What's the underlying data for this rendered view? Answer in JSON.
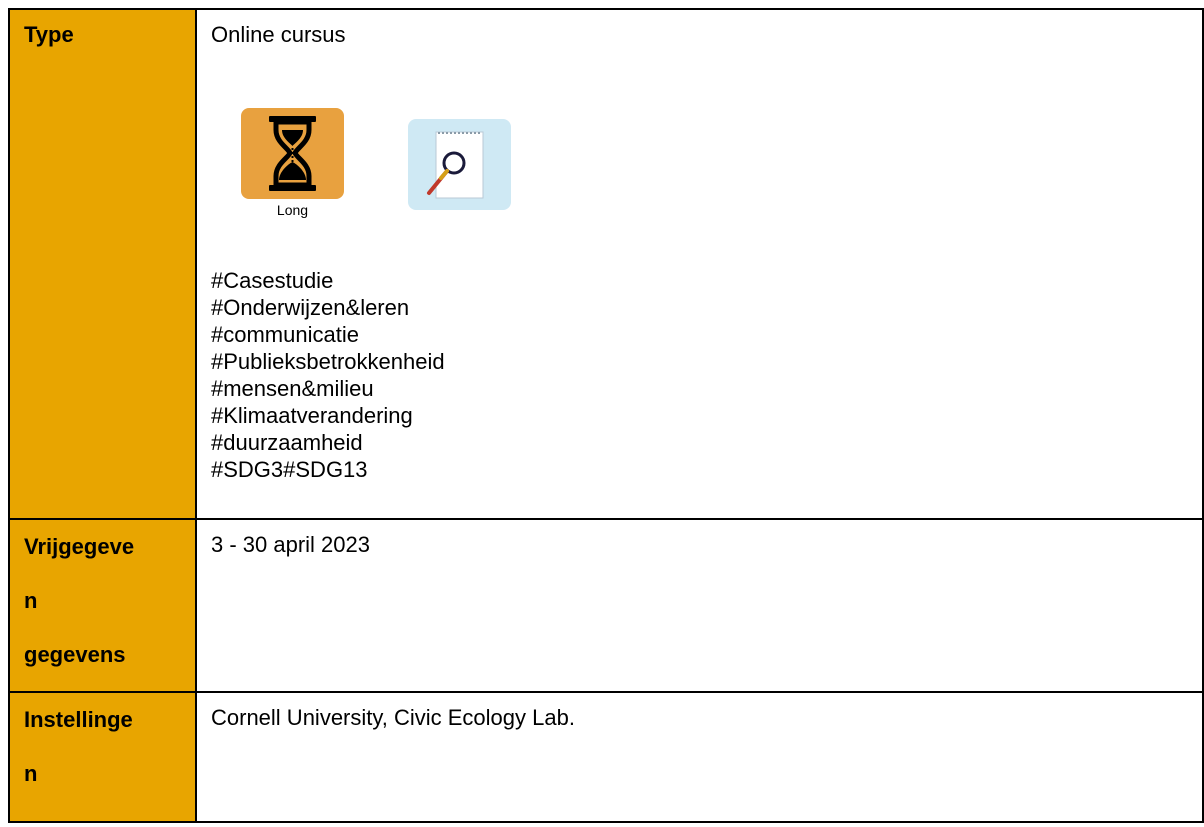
{
  "rows": {
    "type": {
      "label": "Type",
      "value": "Online cursus",
      "icons": {
        "long": {
          "name": "hourglass-icon",
          "caption": "Long",
          "bg": "#e8a13f"
        },
        "search": {
          "name": "magnifier-notepad-icon",
          "bg": "#cfe9f4"
        }
      },
      "tags": [
        "#Casestudie",
        "#Onderwijzen&leren",
        "#communicatie",
        "#Publieksbetrokkenheid",
        "#mensen&milieu",
        "#Klimaatverandering",
        "#duurzaamheid",
        "#SDG3#SDG13"
      ]
    },
    "vrijgegeven": {
      "label_lines": [
        "Vrijgegeve",
        "n",
        "gegevens"
      ],
      "value": "3 - 30 april 2023"
    },
    "instellingen": {
      "label_lines": [
        "Instellinge",
        "n"
      ],
      "value": "Cornell University, Civic Ecology Lab."
    }
  },
  "colors": {
    "label_bg": "#e8a500",
    "border": "#000000"
  }
}
